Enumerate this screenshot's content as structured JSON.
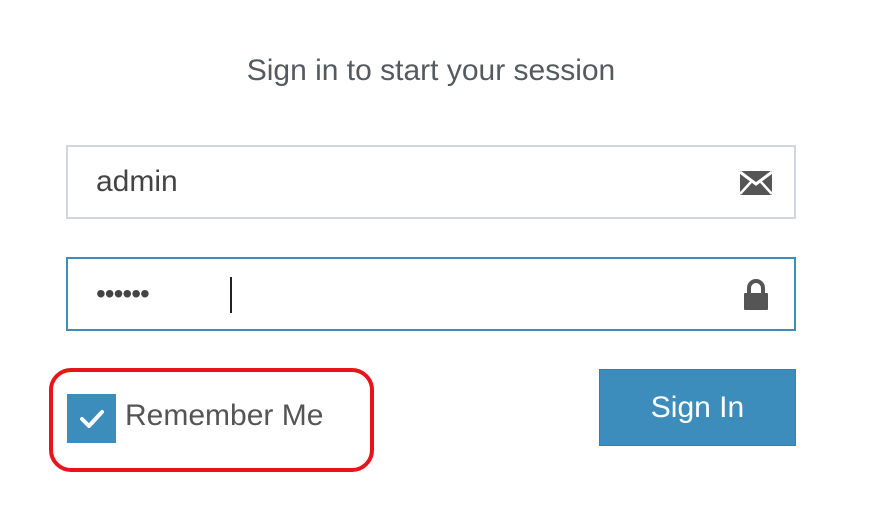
{
  "login": {
    "title": "Sign in to start your session",
    "username": {
      "value": "admin",
      "icon": "envelope-icon"
    },
    "password": {
      "value": "••••••",
      "icon": "lock-icon"
    },
    "remember": {
      "label": "Remember Me",
      "checked": true
    },
    "submit_label": "Sign In"
  },
  "colors": {
    "accent": "#3c8dbc",
    "highlight": "#e8141a",
    "border": "#d2d6de",
    "text": "#555a5f"
  }
}
